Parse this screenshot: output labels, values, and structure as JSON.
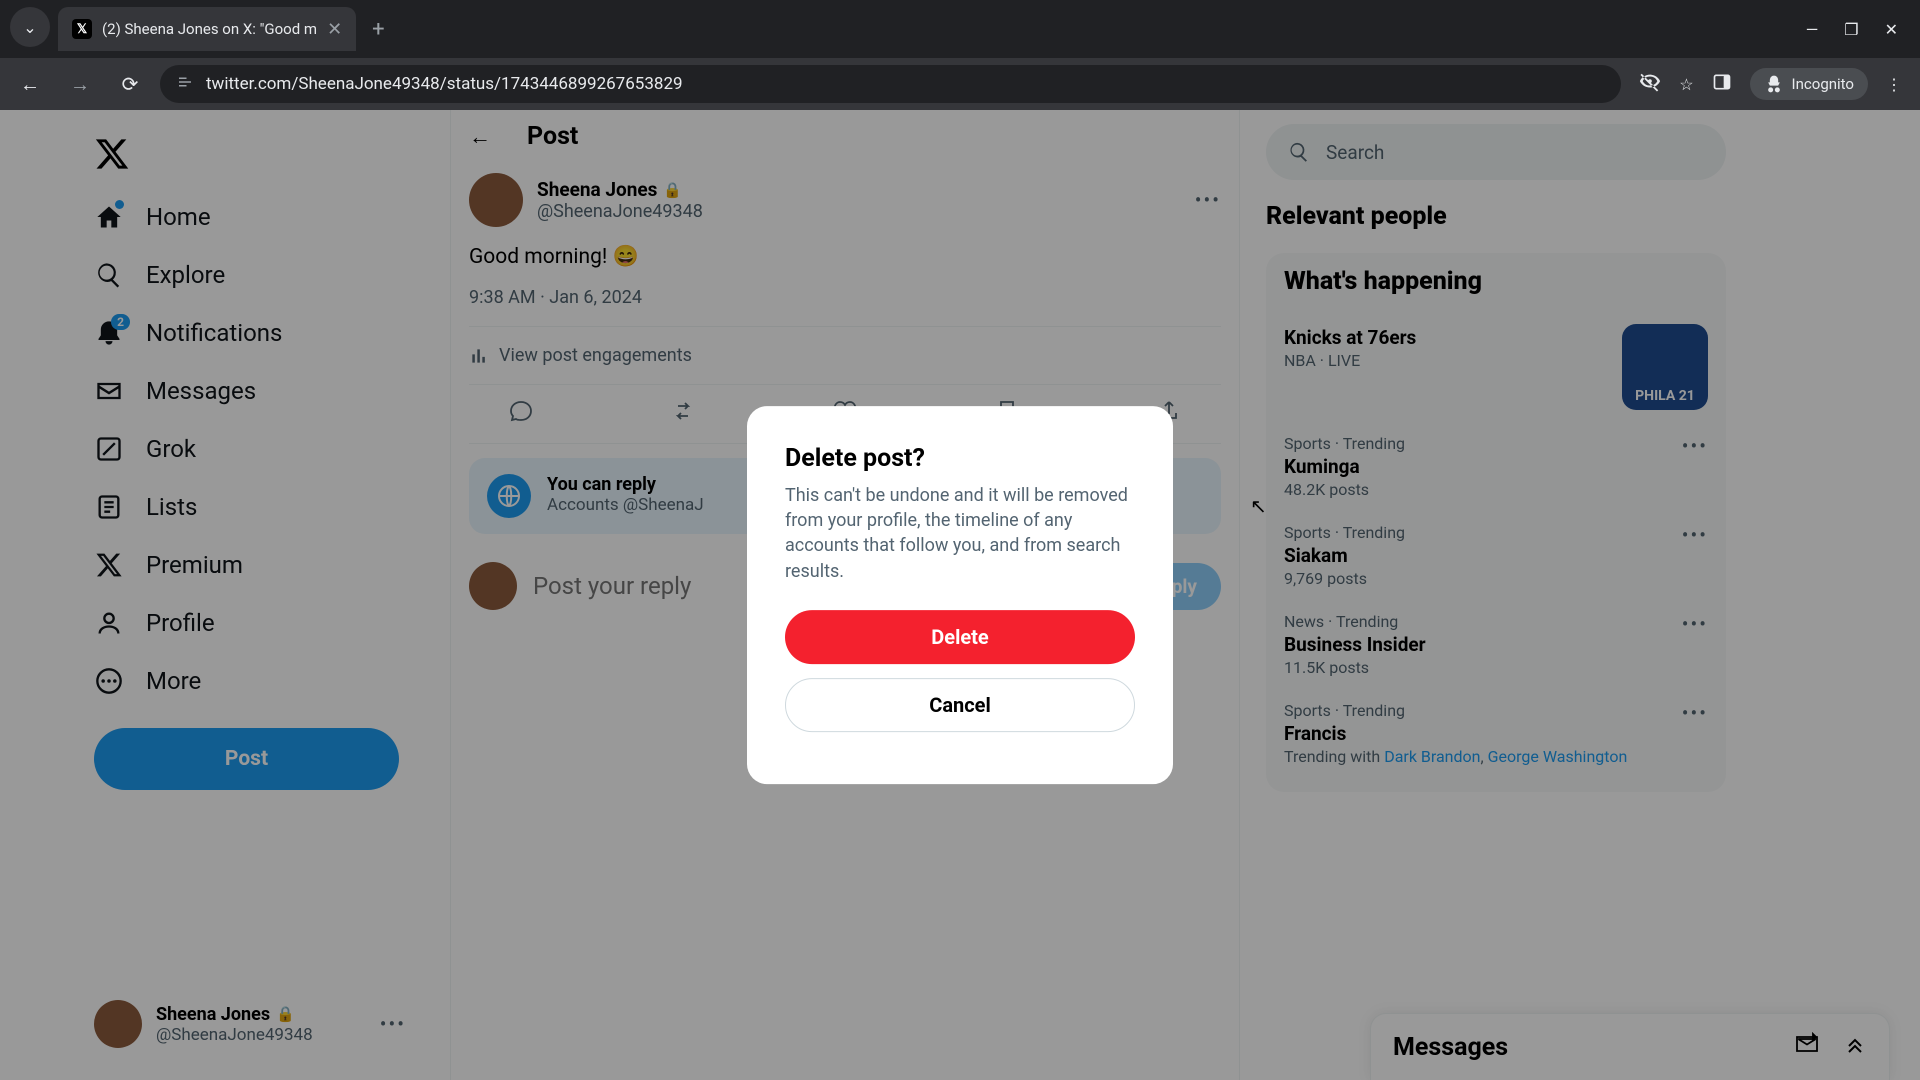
{
  "browser": {
    "tab_title": "(2) Sheena Jones on X: \"Good m",
    "url": "twitter.com/SheenaJone49348/status/1743446899267653829",
    "incognito_label": "Incognito"
  },
  "nav": {
    "home": "Home",
    "explore": "Explore",
    "notifications": "Notifications",
    "notifications_badge": "2",
    "messages": "Messages",
    "grok": "Grok",
    "lists": "Lists",
    "premium": "Premium",
    "profile": "Profile",
    "more": "More",
    "post_button": "Post"
  },
  "account": {
    "name": "Sheena Jones",
    "handle": "@SheenaJone49348"
  },
  "header": {
    "title": "Post"
  },
  "post": {
    "author_name": "Sheena Jones",
    "author_handle": "@SheenaJone49348",
    "text": "Good morning! 😄",
    "time": "9:38 AM",
    "date": "Jan 6, 2024",
    "engagements": "View post engagements",
    "notice_title": "You can reply",
    "notice_text": "Accounts @SheenaJ",
    "reply_placeholder": "Post your reply",
    "reply_button": "Reply"
  },
  "sidebar": {
    "search_placeholder": "Search",
    "relevant_title": "Relevant people",
    "happening_title": "What's happening",
    "trends": [
      {
        "category": "NBA · LIVE",
        "name": "Knicks at 76ers",
        "count": "",
        "thumb_text": "PHILA 21"
      },
      {
        "category": "Sports · Trending",
        "name": "Kuminga",
        "count": "48.2K posts"
      },
      {
        "category": "Sports · Trending",
        "name": "Siakam",
        "count": "9,769 posts"
      },
      {
        "category": "News · Trending",
        "name": "Business Insider",
        "count": "11.5K posts"
      },
      {
        "category": "Sports · Trending",
        "name": "Francis",
        "count": "",
        "trending_with_prefix": "Trending with ",
        "trending_with_1": "Dark Brandon",
        "trending_with_2": "George Washington"
      }
    ],
    "messages_dock": "Messages"
  },
  "modal": {
    "title": "Delete post?",
    "text": "This can't be undone and it will be removed from your profile, the timeline of any accounts that follow you, and from search results.",
    "delete": "Delete",
    "cancel": "Cancel"
  }
}
